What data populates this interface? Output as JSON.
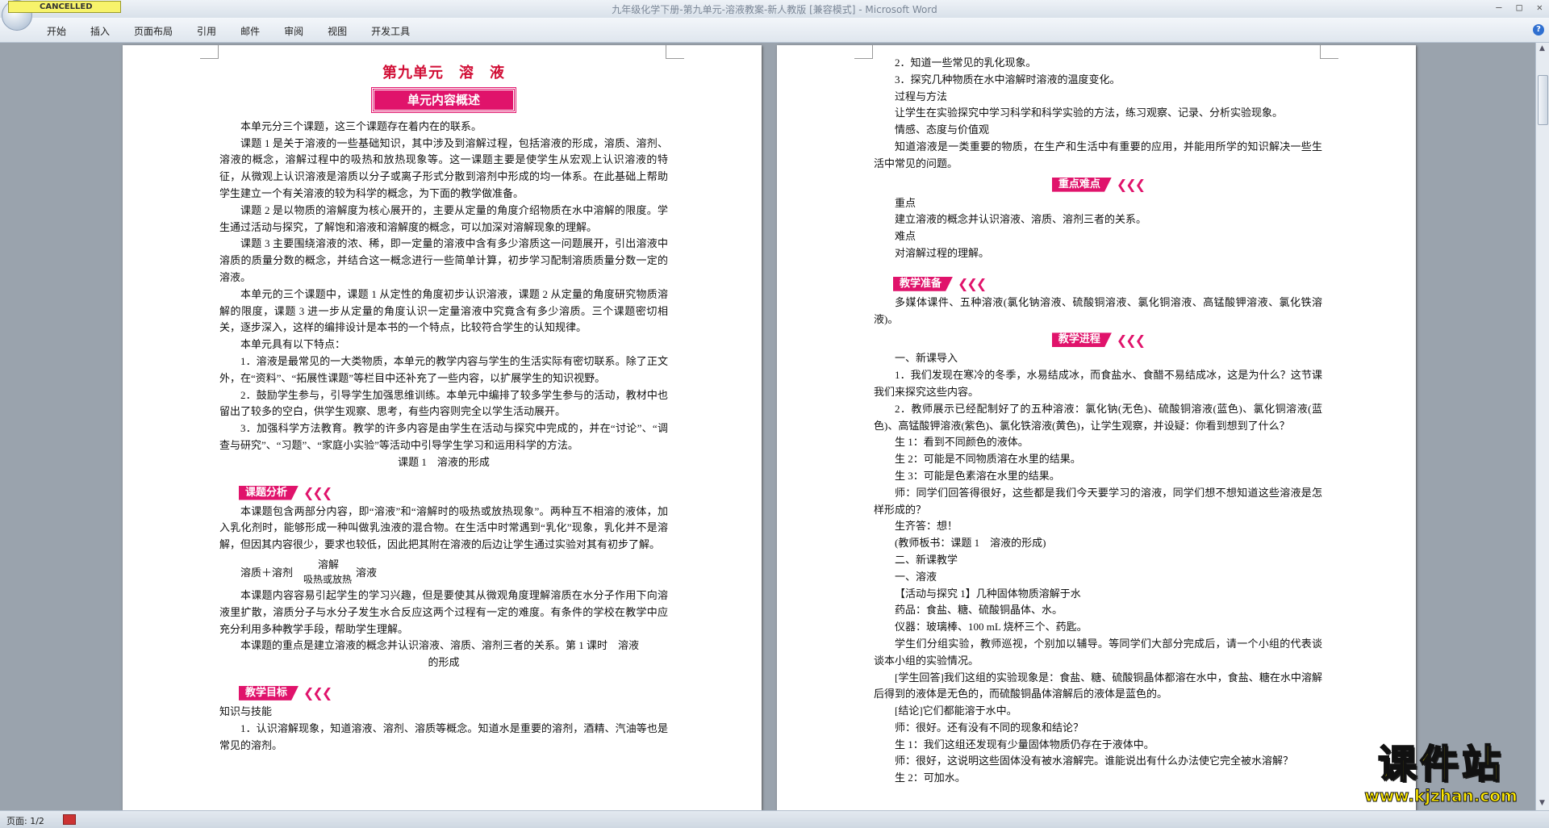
{
  "window": {
    "title": "九年级化学下册-第九单元-溶液教案-新人教版 [兼容模式] - Microsoft Word",
    "cancelled_badge": "CANCELLED",
    "btn_min": "–",
    "btn_max": "□",
    "btn_close": "✕"
  },
  "ribbon": {
    "tabs": [
      "开始",
      "插入",
      "页面布局",
      "引用",
      "邮件",
      "审阅",
      "视图",
      "开发工具"
    ],
    "help": "?"
  },
  "left_page": {
    "title": "第九单元　溶　液",
    "banner": "单元内容概述",
    "paras": [
      "本单元分三个课题，这三个课题存在着内在的联系。",
      "课题 1 是关于溶液的一些基础知识，其中涉及到溶解过程，包括溶液的形成，溶质、溶剂、溶液的概念，溶解过程中的吸热和放热现象等。这一课题主要是使学生从宏观上认识溶液的特征，从微观上认识溶液是溶质以分子或离子形式分散到溶剂中形成的均一体系。在此基础上帮助学生建立一个有关溶液的较为科学的概念，为下面的教学做准备。",
      "课题 2 是以物质的溶解度为核心展开的，主要从定量的角度介绍物质在水中溶解的限度。学生通过活动与探究，了解饱和溶液和溶解度的概念，可以加深对溶解现象的理解。",
      "课题 3 主要围绕溶液的浓、稀，即一定量的溶液中含有多少溶质这一问题展开，引出溶液中溶质的质量分数的概念，并结合这一概念进行一些简单计算，初步学习配制溶质质量分数一定的溶液。",
      "本单元的三个课题中，课题 1 从定性的角度初步认识溶液，课题 2 从定量的角度研究物质溶解的限度，课题 3 进一步从定量的角度认识一定量溶液中究竟含有多少溶质。三个课题密切相关，逐步深入，这样的编排设计是本书的一个特点，比较符合学生的认知规律。",
      "本单元具有以下特点：",
      "1．溶液是最常见的一大类物质，本单元的教学内容与学生的生活实际有密切联系。除了正文外，在“资料”、“拓展性课题”等栏目中还补充了一些内容，以扩展学生的知识视野。",
      "2．鼓励学生参与，引导学生加强思维训练。本单元中编排了较多学生参与的活动，教材中也留出了较多的空白，供学生观察、思考，有些内容则完全以学生活动展开。",
      "3．加强科学方法教育。教学的许多内容是由学生在活动与探究中完成的，并在“讨论”、“调查与研究”、“习题”、“家庭小实验”等活动中引导学生学习和运用科学的方法。"
    ],
    "lesson_title": "课题 1　溶液的形成",
    "tag_analysis": "课题分析",
    "analysis_para": "本课题包含两部分内容，即“溶液”和“溶解时的吸热或放热现象”。两种互不相溶的液体，加入乳化剂时，能够形成一种叫做乳浊液的混合物。在生活中时常遇到“乳化”现象，乳化并不是溶解，但因其内容很少，要求也较低，因此把其附在溶液的后边让学生通过实验对其有初步了解。",
    "eq_line": "溶质＋溶剂　　　　　　溶液",
    "eq_top": "溶解",
    "eq_bot": "吸热或放热",
    "para2": "本课题内容容易引起学生的学习兴趣，但是要使其从微观角度理解溶质在水分子作用下向溶液里扩散，溶质分子与水分子发生水合反应这两个过程有一定的难度。有条件的学校在教学中应充分利用多种教学手段，帮助学生理解。",
    "para3": "本课题的重点是建立溶液的概念并认识溶液、溶质、溶剂三者的关系。第 1 课时　溶液",
    "para3b": "的形成",
    "tag_goals": "教学目标",
    "goals_head": "知识与技能",
    "goals_1": "1．认识溶解现象，知道溶液、溶剂、溶质等概念。知道水是重要的溶剂，酒精、汽油等也是常见的溶剂。"
  },
  "right_page": {
    "lines_a": [
      "2．知道一些常见的乳化现象。",
      "3．探究几种物质在水中溶解时溶液的温度变化。",
      "过程与方法",
      "让学生在实验探究中学习科学和科学实验的方法，练习观察、记录、分析实验现象。",
      "情感、态度与价值观",
      "知道溶液是一类重要的物质，在生产和生活中有重要的应用，并能用所学的知识解决一些生活中常见的问题。"
    ],
    "tag_key": "重点难点",
    "lines_b": [
      "重点",
      "建立溶液的概念并认识溶液、溶质、溶剂三者的关系。",
      "难点",
      "对溶解过程的理解。"
    ],
    "tag_prep": "教学准备",
    "prep_para": "多媒体课件、五种溶液(氯化钠溶液、硫酸铜溶液、氯化铜溶液、高锰酸钾溶液、氯化铁溶液)。",
    "tag_process": "教学进程",
    "lines_c": [
      "一、新课导入",
      "1．我们发现在寒冷的冬季，水易结成冰，而食盐水、食醋不易结成冰，这是为什么？这节课我们来探究这些内容。",
      "2．教师展示已经配制好了的五种溶液：氯化钠(无色)、硫酸铜溶液(蓝色)、氯化铜溶液(蓝色)、高锰酸钾溶液(紫色)、氯化铁溶液(黄色)，让学生观察，并设疑：你看到想到了什么？",
      "生 1：看到不同颜色的液体。",
      "生 2：可能是不同物质溶在水里的结果。",
      "生 3：可能是色素溶在水里的结果。",
      "师：同学们回答得很好，这些都是我们今天要学习的溶液，同学们想不想知道这些溶液是怎样形成的？",
      "生齐答：想！",
      "(教师板书：课题 1　溶液的形成)",
      "二、新课教学",
      "一、溶液",
      "【活动与探究 1】几种固体物质溶解于水",
      "药品：食盐、糖、硫酸铜晶体、水。",
      "仪器：玻璃棒、100 mL 烧杯三个、药匙。",
      "学生们分组实验，教师巡视，个别加以辅导。等同学们大部分完成后，请一个小组的代表谈谈本小组的实验情况。",
      "[学生回答]我们这组的实验现象是：食盐、糖、硫酸铜晶体都溶在水中，食盐、糖在水中溶解后得到的液体是无色的，而硫酸铜晶体溶解后的液体是蓝色的。",
      "[结论]它们都能溶于水中。",
      "师：很好。还有没有不同的现象和结论？",
      "生 1：我们这组还发现有少量固体物质仍存在于液体中。",
      "师：很好，这说明这些固体没有被水溶解完。谁能说出有什么办法使它完全被水溶解？",
      "生 2：可加水。"
    ]
  },
  "statusbar": {
    "page": "页面: 1/2"
  },
  "watermark": {
    "big": "课件站",
    "url": "www.kjzhan.com"
  },
  "colors": {
    "accent": "#e0136b",
    "title_red": "#d10d35"
  }
}
